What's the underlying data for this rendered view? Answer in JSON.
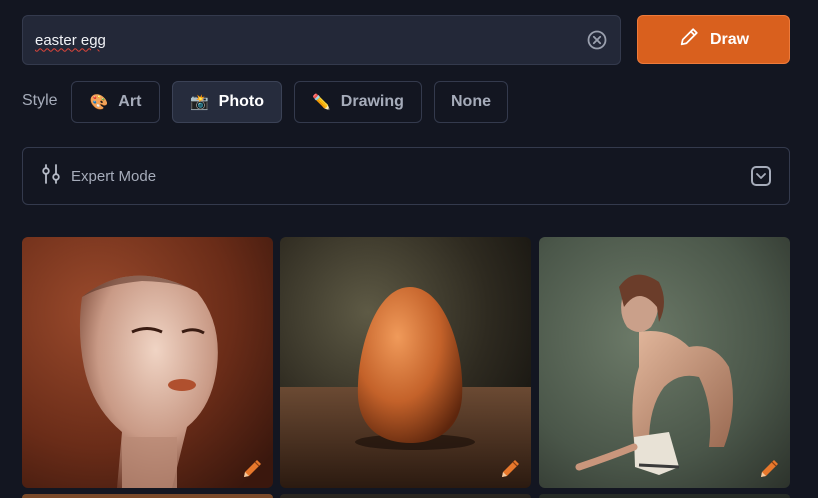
{
  "search": {
    "value": "easter egg"
  },
  "actions": {
    "draw_label": "Draw"
  },
  "style_selector": {
    "label": "Style",
    "options": [
      {
        "label": "Art",
        "icon": "palette-icon"
      },
      {
        "label": "Photo",
        "icon": "camera-icon",
        "selected": true
      },
      {
        "label": "Drawing",
        "icon": "pencil-icon"
      },
      {
        "label": "None"
      }
    ]
  },
  "expert_mode": {
    "label": "Expert Mode",
    "expanded": false
  },
  "gallery": {
    "images": [
      {
        "subject": "portrait of a woman",
        "edit_icon": "edit-pencil-icon"
      },
      {
        "subject": "brown egg on a table",
        "edit_icon": "edit-pencil-icon"
      },
      {
        "subject": "seated figure with shoes",
        "edit_icon": "edit-pencil-icon"
      }
    ]
  },
  "colors": {
    "background": "#131621",
    "accent": "#d9601e",
    "surface": "#232838",
    "border": "#343a4d"
  }
}
